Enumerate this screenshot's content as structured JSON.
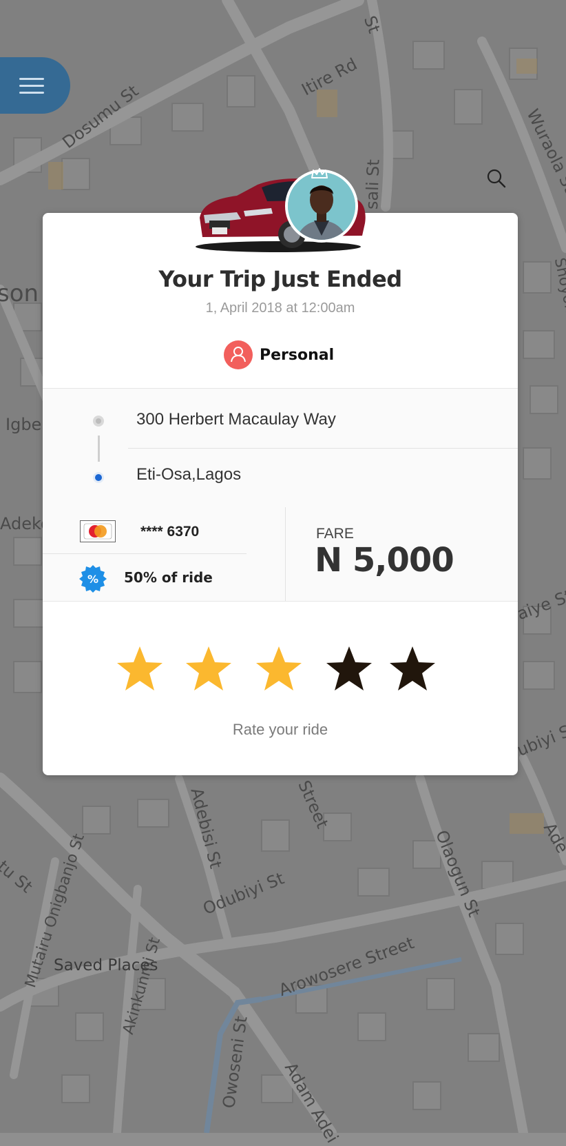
{
  "map": {
    "street_labels": [
      "Itire Rd",
      "Dosumu St",
      "Wuraola St",
      "sali St",
      "son P",
      "Igbe",
      "Shoyombo",
      "Adeko",
      "aiye St",
      "ubiyi S",
      "Adebisi St",
      "Street",
      "Olaogun St",
      "Odubiyi St",
      "tu St",
      "Mutairu Onigbanjo St",
      "Akinkunmi St",
      "Arowosere Street",
      "Owoseni St",
      "Adam Adei",
      "Ade",
      "St"
    ],
    "saved_places_label": "Saved Places"
  },
  "header": {
    "menu_icon": "hamburger-icon",
    "search_icon": "search-icon"
  },
  "trip": {
    "title": "Your Trip Just Ended",
    "datetime": "1, April 2018 at 12:00am",
    "ride_type": "Personal",
    "pickup": "300 Herbert Macaulay Way",
    "dropoff": "Eti-Osa,Lagos",
    "card_brand": "MasterCard",
    "card_masked": "****  6370",
    "promo": "50% of ride",
    "fare_label": "FARE",
    "fare_value": "N 5,000"
  },
  "rating": {
    "stars_filled": 3,
    "stars_total": 5,
    "prompt": "Rate your ride"
  },
  "colors": {
    "star_filled": "#fbb82f",
    "star_empty": "#21160c",
    "accent_red": "#f25f5c",
    "accent_blue": "#1b67d3",
    "menu_bg": "#356a94"
  }
}
